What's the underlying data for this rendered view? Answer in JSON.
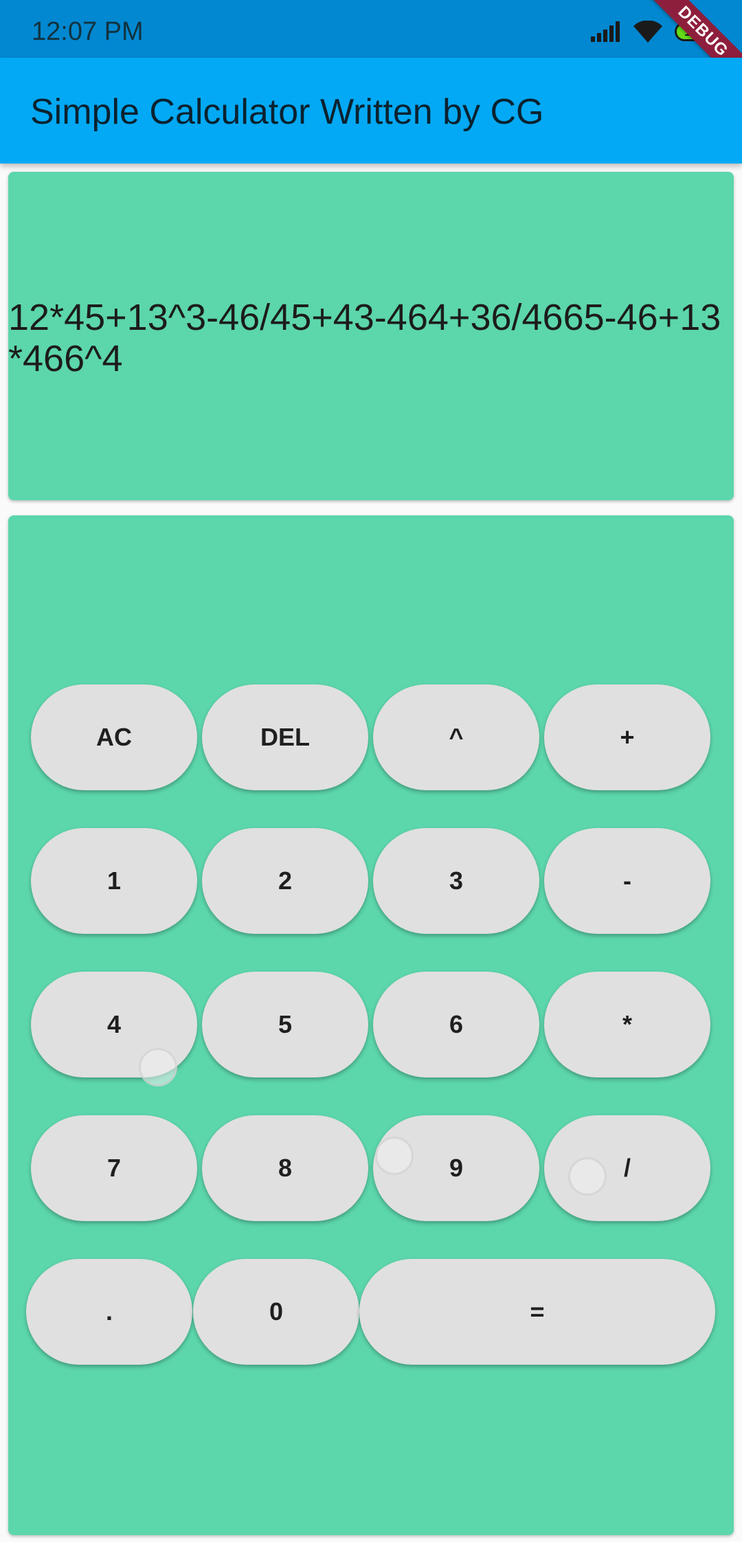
{
  "status_bar": {
    "time": "12:07  PM",
    "battery": "100"
  },
  "debug_banner": "DEBUG",
  "app_bar": {
    "title": "Simple Calculator Written by CG"
  },
  "display": {
    "expression": "12*45+13^3-46/45+43-464+36/4665-46+13*466^4"
  },
  "keypad": {
    "rows": [
      [
        "AC",
        "DEL",
        "^",
        "+"
      ],
      [
        "1",
        "2",
        "3",
        "-"
      ],
      [
        "4",
        "5",
        "6",
        "*"
      ],
      [
        "7",
        "8",
        "9",
        "/"
      ],
      [
        ".",
        "0",
        "="
      ]
    ]
  },
  "colors": {
    "status_bar": "#0288d1",
    "app_bar": "#03a9f4",
    "card": "#5cd6ab",
    "key": "#e0e0e0"
  }
}
